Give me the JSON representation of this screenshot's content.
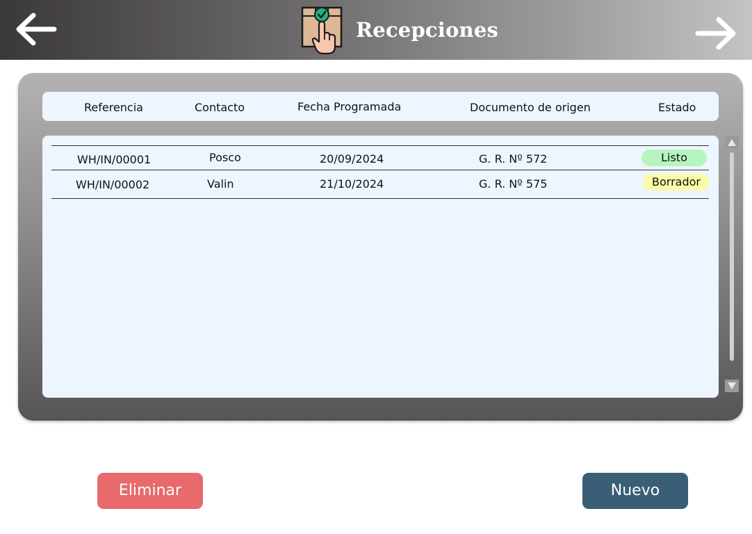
{
  "header": {
    "title": "Recepciones",
    "back_icon": "arrow-left-icon",
    "forward_icon": "arrow-right-icon",
    "title_icon": "package-hand-check-icon"
  },
  "table": {
    "columns": [
      "Referencia",
      "Contacto",
      "Fecha Programada",
      "Documento de origen",
      "Estado"
    ],
    "rows": [
      {
        "reference": "WH/IN/00001",
        "contact": "Posco",
        "scheduled_date": "20/09/2024",
        "source_document": "G. R. Nº 572",
        "status": "Listo"
      },
      {
        "reference": "WH/IN/00002",
        "contact": "Valin",
        "scheduled_date": "21/10/2024",
        "source_document": "G. R. Nº 575",
        "status": "Borrador"
      }
    ]
  },
  "actions": {
    "delete_label": "Eliminar",
    "new_label": "Nuevo"
  },
  "colors": {
    "status_listo": "#b6f5c0",
    "status_borrador": "#fafaa8",
    "delete_button": "#e86a6c",
    "new_button": "#3a5e76"
  }
}
